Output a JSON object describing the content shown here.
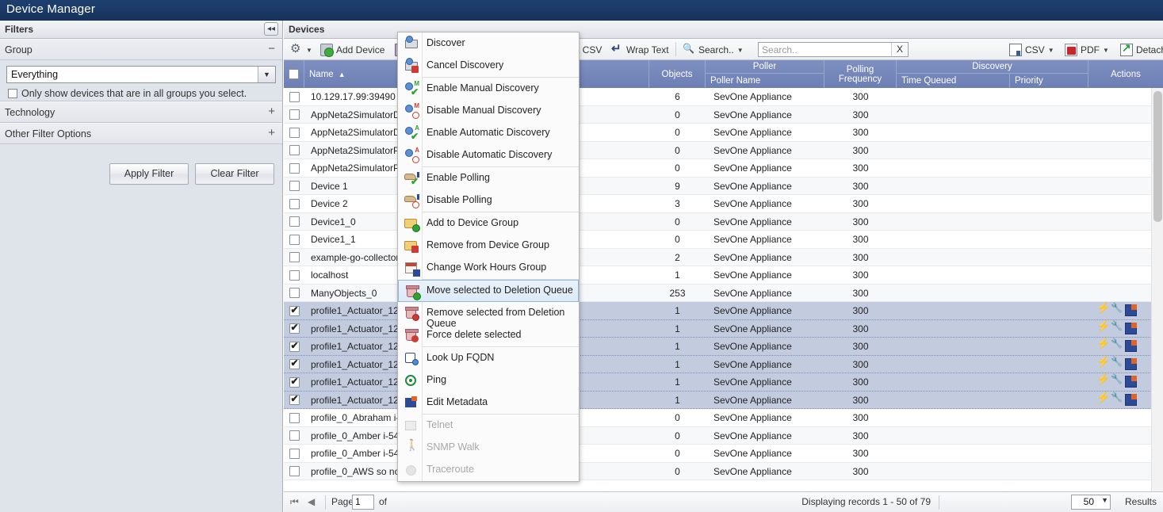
{
  "window": {
    "title": "Device Manager"
  },
  "filters": {
    "header": "Filters",
    "collapse_icon": "collapse-left-icon",
    "sections": [
      {
        "name": "Group",
        "toggle": "−"
      },
      {
        "name": "Technology",
        "toggle": "+"
      },
      {
        "name": "Other Filter Options",
        "toggle": "+"
      }
    ],
    "group": {
      "selected": "Everything",
      "checkbox_label": "Only show devices that are in all groups you select.",
      "checked": false
    },
    "apply_label": "Apply Filter",
    "clear_label": "Clear Filter"
  },
  "devices": {
    "header": "Devices",
    "toolbar": {
      "settings_icon": "gear-icon",
      "add_device": "Add Device",
      "delete_icon": "trash-icon",
      "export_csv": "t CSV",
      "wrap_text": "Wrap Text",
      "search_menu": "Search..",
      "search_value": "",
      "search_placeholder": "Search..",
      "clear_search": "X",
      "csv": "CSV",
      "pdf": "PDF",
      "detach": "Detach"
    },
    "columns": {
      "name": "Name",
      "sort_indicator": "▲",
      "objects": "Objects",
      "poller_group": "Poller",
      "poller_name": "Poller Name",
      "polling_frequency": "Polling Frequency",
      "discovery_group": "Discovery",
      "time_queued": "Time Queued",
      "priority": "Priority",
      "actions": "Actions"
    },
    "rows": [
      {
        "checked": false,
        "name": "10.129.17.99:39490",
        "objects": "6",
        "poller": "SevOne Appliance",
        "freq": "300",
        "queued": "",
        "priority": "",
        "actions": false
      },
      {
        "checked": false,
        "name": "AppNeta2SimulatorDev",
        "objects": "0",
        "poller": "SevOne Appliance",
        "freq": "300",
        "queued": "",
        "priority": "",
        "actions": false
      },
      {
        "checked": false,
        "name": "AppNeta2SimulatorDev",
        "objects": "0",
        "poller": "SevOne Appliance",
        "freq": "300",
        "queued": "",
        "priority": "",
        "actions": false
      },
      {
        "checked": false,
        "name": "AppNeta2SimulatorPath",
        "objects": "0",
        "poller": "SevOne Appliance",
        "freq": "300",
        "queued": "",
        "priority": "",
        "actions": false
      },
      {
        "checked": false,
        "name": "AppNeta2SimulatorPath",
        "objects": "0",
        "poller": "SevOne Appliance",
        "freq": "300",
        "queued": "",
        "priority": "",
        "actions": false
      },
      {
        "checked": false,
        "name": "Device 1",
        "objects": "9",
        "poller": "SevOne Appliance",
        "freq": "300",
        "queued": "",
        "priority": "",
        "actions": false
      },
      {
        "checked": false,
        "name": "Device 2",
        "objects": "3",
        "poller": "SevOne Appliance",
        "freq": "300",
        "queued": "",
        "priority": "",
        "actions": false
      },
      {
        "checked": false,
        "name": "Device1_0",
        "objects": "0",
        "poller": "SevOne Appliance",
        "freq": "300",
        "queued": "",
        "priority": "",
        "actions": false
      },
      {
        "checked": false,
        "name": "Device1_1",
        "objects": "0",
        "poller": "SevOne Appliance",
        "freq": "300",
        "queued": "",
        "priority": "",
        "actions": false
      },
      {
        "checked": false,
        "name": "example-go-collector",
        "objects": "2",
        "poller": "SevOne Appliance",
        "freq": "300",
        "queued": "",
        "priority": "",
        "actions": false
      },
      {
        "checked": false,
        "name": "localhost",
        "objects": "1",
        "poller": "SevOne Appliance",
        "freq": "300",
        "queued": "",
        "priority": "",
        "actions": false
      },
      {
        "checked": false,
        "name": "ManyObjects_0",
        "objects": "253",
        "poller": "SevOne Appliance",
        "freq": "300",
        "queued": "",
        "priority": "",
        "actions": false
      },
      {
        "checked": true,
        "name": "profile1_Actuator_123",
        "objects": "1",
        "poller": "SevOne Appliance",
        "freq": "300",
        "queued": "",
        "priority": "",
        "actions": true
      },
      {
        "checked": true,
        "name": "profile1_Actuator_124",
        "objects": "1",
        "poller": "SevOne Appliance",
        "freq": "300",
        "queued": "",
        "priority": "",
        "actions": true
      },
      {
        "checked": true,
        "name": "profile1_Actuator_125",
        "objects": "1",
        "poller": "SevOne Appliance",
        "freq": "300",
        "queued": "",
        "priority": "",
        "actions": true
      },
      {
        "checked": true,
        "name": "profile1_Actuator_126",
        "objects": "1",
        "poller": "SevOne Appliance",
        "freq": "300",
        "queued": "",
        "priority": "",
        "actions": true
      },
      {
        "checked": true,
        "name": "profile1_Actuator_127",
        "objects": "1",
        "poller": "SevOne Appliance",
        "freq": "300",
        "queued": "",
        "priority": "",
        "actions": true
      },
      {
        "checked": true,
        "name": "profile1_Actuator_128",
        "objects": "1",
        "poller": "SevOne Appliance",
        "freq": "300",
        "queued": "",
        "priority": "",
        "actions": true
      },
      {
        "checked": false,
        "name": "profile_0_Abraham i-54",
        "objects": "0",
        "poller": "SevOne Appliance",
        "freq": "300",
        "queued": "",
        "priority": "",
        "actions": false
      },
      {
        "checked": false,
        "name": "profile_0_Amber i-54e4",
        "objects": "0",
        "poller": "SevOne Appliance",
        "freq": "300",
        "queued": "",
        "priority": "",
        "actions": false
      },
      {
        "checked": false,
        "name": "profile_0_Amber i-54e4",
        "objects": "0",
        "poller": "SevOne Appliance",
        "freq": "300",
        "queued": "",
        "priority": "",
        "actions": false
      },
      {
        "checked": false,
        "name": "profile_0_AWS so north",
        "objects": "0",
        "poller": "SevOne Appliance",
        "freq": "300",
        "queued": "",
        "priority": "",
        "actions": false
      }
    ],
    "footer": {
      "first_icon": "⏮",
      "prev_icon": "◀",
      "page_label": "Page",
      "page_value": "1",
      "of_label": "of",
      "records": "Displaying records 1 - 50 of 79",
      "page_size": "50",
      "results_label": "Results"
    }
  },
  "context_menu": {
    "items": [
      {
        "label": "Discover",
        "icon": "discover-icon",
        "disabled": false,
        "highlighted": false
      },
      {
        "label": "Cancel Discovery",
        "icon": "cancel-discovery-icon",
        "disabled": false,
        "highlighted": false
      },
      {
        "divider": true
      },
      {
        "label": "Enable Manual Discovery",
        "icon": "enable-manual-discovery-icon",
        "disabled": false,
        "highlighted": false
      },
      {
        "label": "Disable Manual Discovery",
        "icon": "disable-manual-discovery-icon",
        "disabled": false,
        "highlighted": false
      },
      {
        "label": "Enable Automatic Discovery",
        "icon": "enable-automatic-discovery-icon",
        "disabled": false,
        "highlighted": false
      },
      {
        "label": "Disable Automatic Discovery",
        "icon": "disable-automatic-discovery-icon",
        "disabled": false,
        "highlighted": false
      },
      {
        "divider": true
      },
      {
        "label": "Enable Polling",
        "icon": "enable-polling-icon",
        "disabled": false,
        "highlighted": false
      },
      {
        "label": "Disable Polling",
        "icon": "disable-polling-icon",
        "disabled": false,
        "highlighted": false
      },
      {
        "divider": true
      },
      {
        "label": "Add to Device Group",
        "icon": "add-to-device-group-icon",
        "disabled": false,
        "highlighted": false
      },
      {
        "label": "Remove from Device Group",
        "icon": "remove-from-device-group-icon",
        "disabled": false,
        "highlighted": false
      },
      {
        "label": "Change Work Hours Group",
        "icon": "change-work-hours-group-icon",
        "disabled": false,
        "highlighted": false
      },
      {
        "divider": true
      },
      {
        "label": "Move selected to Deletion Queue",
        "icon": "move-to-deletion-queue-icon",
        "disabled": false,
        "highlighted": true
      },
      {
        "label": "Remove selected from Deletion Queue",
        "icon": "remove-from-deletion-queue-icon",
        "disabled": false,
        "highlighted": false
      },
      {
        "label": "Force delete selected",
        "icon": "force-delete-icon",
        "disabled": false,
        "highlighted": false
      },
      {
        "divider": true
      },
      {
        "label": "Look Up FQDN",
        "icon": "lookup-fqdn-icon",
        "disabled": false,
        "highlighted": false
      },
      {
        "label": "Ping",
        "icon": "ping-icon",
        "disabled": false,
        "highlighted": false
      },
      {
        "label": "Edit Metadata",
        "icon": "edit-metadata-icon",
        "disabled": false,
        "highlighted": false
      },
      {
        "divider": true
      },
      {
        "label": "Telnet",
        "icon": "telnet-icon",
        "disabled": true,
        "highlighted": false
      },
      {
        "label": "SNMP Walk",
        "icon": "snmp-walk-icon",
        "disabled": true,
        "highlighted": false
      },
      {
        "label": "Traceroute",
        "icon": "traceroute-icon",
        "disabled": true,
        "highlighted": false
      }
    ]
  },
  "colors": {
    "titlebar": "#1b3a66",
    "header_row": "#6c7fb4",
    "selected_row": "#c3ccdf",
    "highlight": "#dceaf8"
  }
}
